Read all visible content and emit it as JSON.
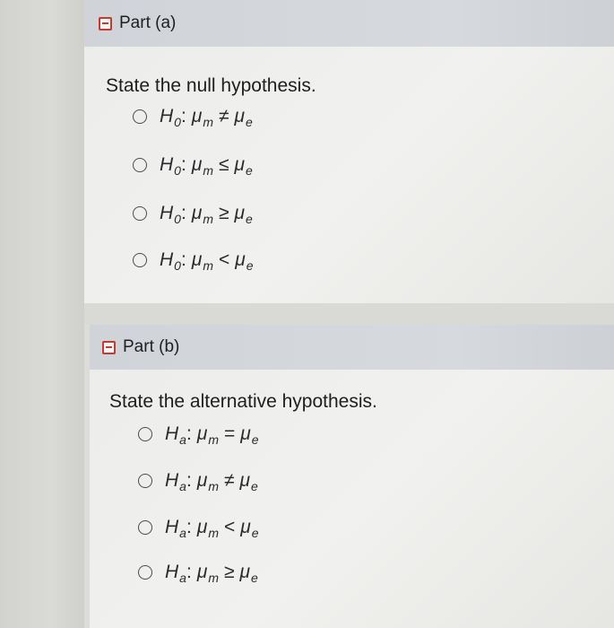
{
  "part_a": {
    "title": "Part (a)",
    "prompt": "State the null hypothesis.",
    "options": [
      {
        "hyp": "H",
        "hyp_sub": "0",
        "lhs": "μ",
        "lhs_sub": "m",
        "op": "≠",
        "rhs": "μ",
        "rhs_sub": "e"
      },
      {
        "hyp": "H",
        "hyp_sub": "0",
        "lhs": "μ",
        "lhs_sub": "m",
        "op": "≤",
        "rhs": "μ",
        "rhs_sub": "e"
      },
      {
        "hyp": "H",
        "hyp_sub": "0",
        "lhs": "μ",
        "lhs_sub": "m",
        "op": "≥",
        "rhs": "μ",
        "rhs_sub": "e"
      },
      {
        "hyp": "H",
        "hyp_sub": "0",
        "lhs": "μ",
        "lhs_sub": "m",
        "op": "<",
        "rhs": "μ",
        "rhs_sub": "e"
      }
    ]
  },
  "part_b": {
    "title": "Part (b)",
    "prompt": "State the alternative hypothesis.",
    "options": [
      {
        "hyp": "H",
        "hyp_sub": "a",
        "lhs": "μ",
        "lhs_sub": "m",
        "op": "=",
        "rhs": "μ",
        "rhs_sub": "e"
      },
      {
        "hyp": "H",
        "hyp_sub": "a",
        "lhs": "μ",
        "lhs_sub": "m",
        "op": "≠",
        "rhs": "μ",
        "rhs_sub": "e"
      },
      {
        "hyp": "H",
        "hyp_sub": "a",
        "lhs": "μ",
        "lhs_sub": "m",
        "op": "<",
        "rhs": "μ",
        "rhs_sub": "e"
      },
      {
        "hyp": "H",
        "hyp_sub": "a",
        "lhs": "μ",
        "lhs_sub": "m",
        "op": "≥",
        "rhs": "μ",
        "rhs_sub": "e"
      }
    ]
  },
  "colors": {
    "collapse_icon": "#c53a2e",
    "header_bg": "#d3d6da"
  }
}
